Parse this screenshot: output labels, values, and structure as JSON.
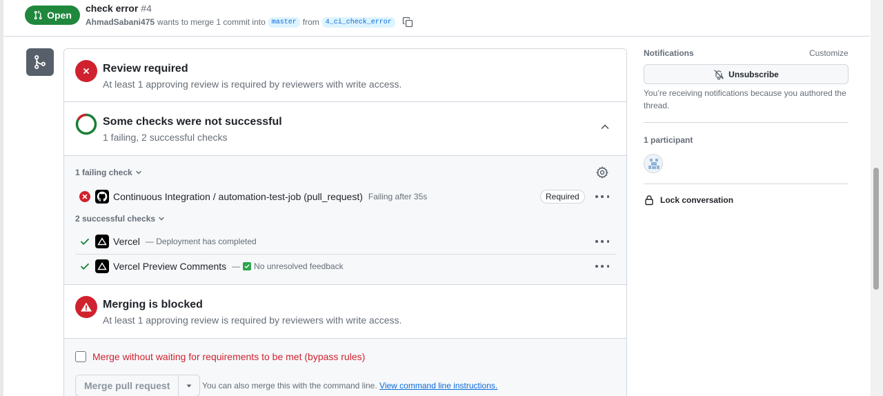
{
  "pr": {
    "state": "Open",
    "title": "check error",
    "number": "#4",
    "author": "AhmadSabani475",
    "action_text": "wants to merge 1 commit into",
    "base_branch": "master",
    "from_text": "from",
    "head_branch": "4_ci_check_error"
  },
  "mergebox": {
    "review": {
      "title": "Review required",
      "subtitle": "At least 1 approving review is required by reviewers with write access."
    },
    "checks": {
      "title": "Some checks were not successful",
      "subtitle": "1 failing, 2 successful checks",
      "failing_group": "1 failing check",
      "successful_group": "2 successful checks",
      "failing": [
        {
          "name": "Continuous Integration / automation-test-job (pull_request)",
          "description": "Failing after 35s",
          "badge": "Required",
          "status": "failure",
          "app_icon": "github-icon"
        }
      ],
      "successful": [
        {
          "name": "Vercel",
          "description": "— Deployment has completed",
          "status": "success",
          "app_icon": "vercel-icon"
        },
        {
          "name": "Vercel Preview Comments",
          "dash": "—",
          "description": "No unresolved feedback",
          "status": "success",
          "app_icon": "vercel-icon"
        }
      ]
    },
    "blocked": {
      "title": "Merging is blocked",
      "subtitle": "At least 1 approving review is required by reviewers with write access."
    },
    "merge": {
      "bypass_label": "Merge without waiting for requirements to be met (bypass rules)",
      "button_label": "Merge pull request",
      "cli_text": "You can also merge this with the command line.",
      "cli_link": "View command line instructions."
    }
  },
  "sidebar": {
    "notifications_label": "Notifications",
    "customize_label": "Customize",
    "unsubscribe_label": "Unsubscribe",
    "notification_note": "You’re receiving notifications because you authored the thread.",
    "participants_label": "1 participant",
    "lock_label": "Lock conversation"
  },
  "colors": {
    "open_green": "#1f883d",
    "danger_red": "#cf222e",
    "success_green": "#1a7f37",
    "link_blue": "#0969da"
  }
}
